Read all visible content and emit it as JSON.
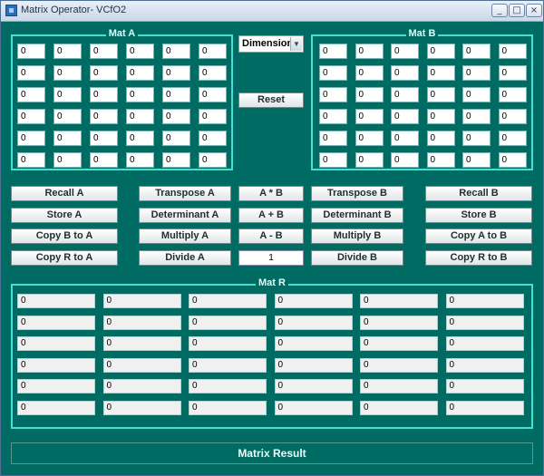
{
  "window": {
    "title": "Matrix Operator- VCfO2",
    "controls": [
      "minimize",
      "maximize",
      "close"
    ]
  },
  "mat_a": {
    "title": "Mat A",
    "cells": [
      [
        "0",
        "0",
        "0",
        "0",
        "0",
        "0"
      ],
      [
        "0",
        "0",
        "0",
        "0",
        "0",
        "0"
      ],
      [
        "0",
        "0",
        "0",
        "0",
        "0",
        "0"
      ],
      [
        "0",
        "0",
        "0",
        "0",
        "0",
        "0"
      ],
      [
        "0",
        "0",
        "0",
        "0",
        "0",
        "0"
      ],
      [
        "0",
        "0",
        "0",
        "0",
        "0",
        "0"
      ]
    ]
  },
  "mat_b": {
    "title": "Mat B",
    "cells": [
      [
        "0",
        "0",
        "0",
        "0",
        "0",
        "0"
      ],
      [
        "0",
        "0",
        "0",
        "0",
        "0",
        "0"
      ],
      [
        "0",
        "0",
        "0",
        "0",
        "0",
        "0"
      ],
      [
        "0",
        "0",
        "0",
        "0",
        "0",
        "0"
      ],
      [
        "0",
        "0",
        "0",
        "0",
        "0",
        "0"
      ],
      [
        "0",
        "0",
        "0",
        "0",
        "0",
        "0"
      ]
    ]
  },
  "mat_r": {
    "title": "Mat R",
    "cells": [
      [
        "0",
        "0",
        "0",
        "0",
        "0",
        "0"
      ],
      [
        "0",
        "0",
        "0",
        "0",
        "0",
        "0"
      ],
      [
        "0",
        "0",
        "0",
        "0",
        "0",
        "0"
      ],
      [
        "0",
        "0",
        "0",
        "0",
        "0",
        "0"
      ],
      [
        "0",
        "0",
        "0",
        "0",
        "0",
        "0"
      ],
      [
        "0",
        "0",
        "0",
        "0",
        "0",
        "0"
      ]
    ]
  },
  "dimension": {
    "label": "Dimension"
  },
  "reset": {
    "label": "Reset"
  },
  "buttons": {
    "recall_a": "Recall A",
    "store_a": "Store A",
    "copy_b_to_a": "Copy B to A",
    "copy_r_to_a": "Copy R to A",
    "transpose_a": "Transpose A",
    "determinant_a": "Determinant A",
    "multiply_a": "Multiply A",
    "divide_a": "Divide A",
    "a_times_b": "A * B",
    "a_plus_b": "A + B",
    "a_minus_b": "A - B",
    "transpose_b": "Transpose B",
    "determinant_b": "Determinant B",
    "multiply_b": "Multiply B",
    "divide_b": "Divide B",
    "recall_b": "Recall B",
    "store_b": "Store B",
    "copy_a_to_b": "Copy A to B",
    "copy_r_to_b": "Copy R to B"
  },
  "scalar_value": "1",
  "status": {
    "text": "Matrix Result"
  }
}
